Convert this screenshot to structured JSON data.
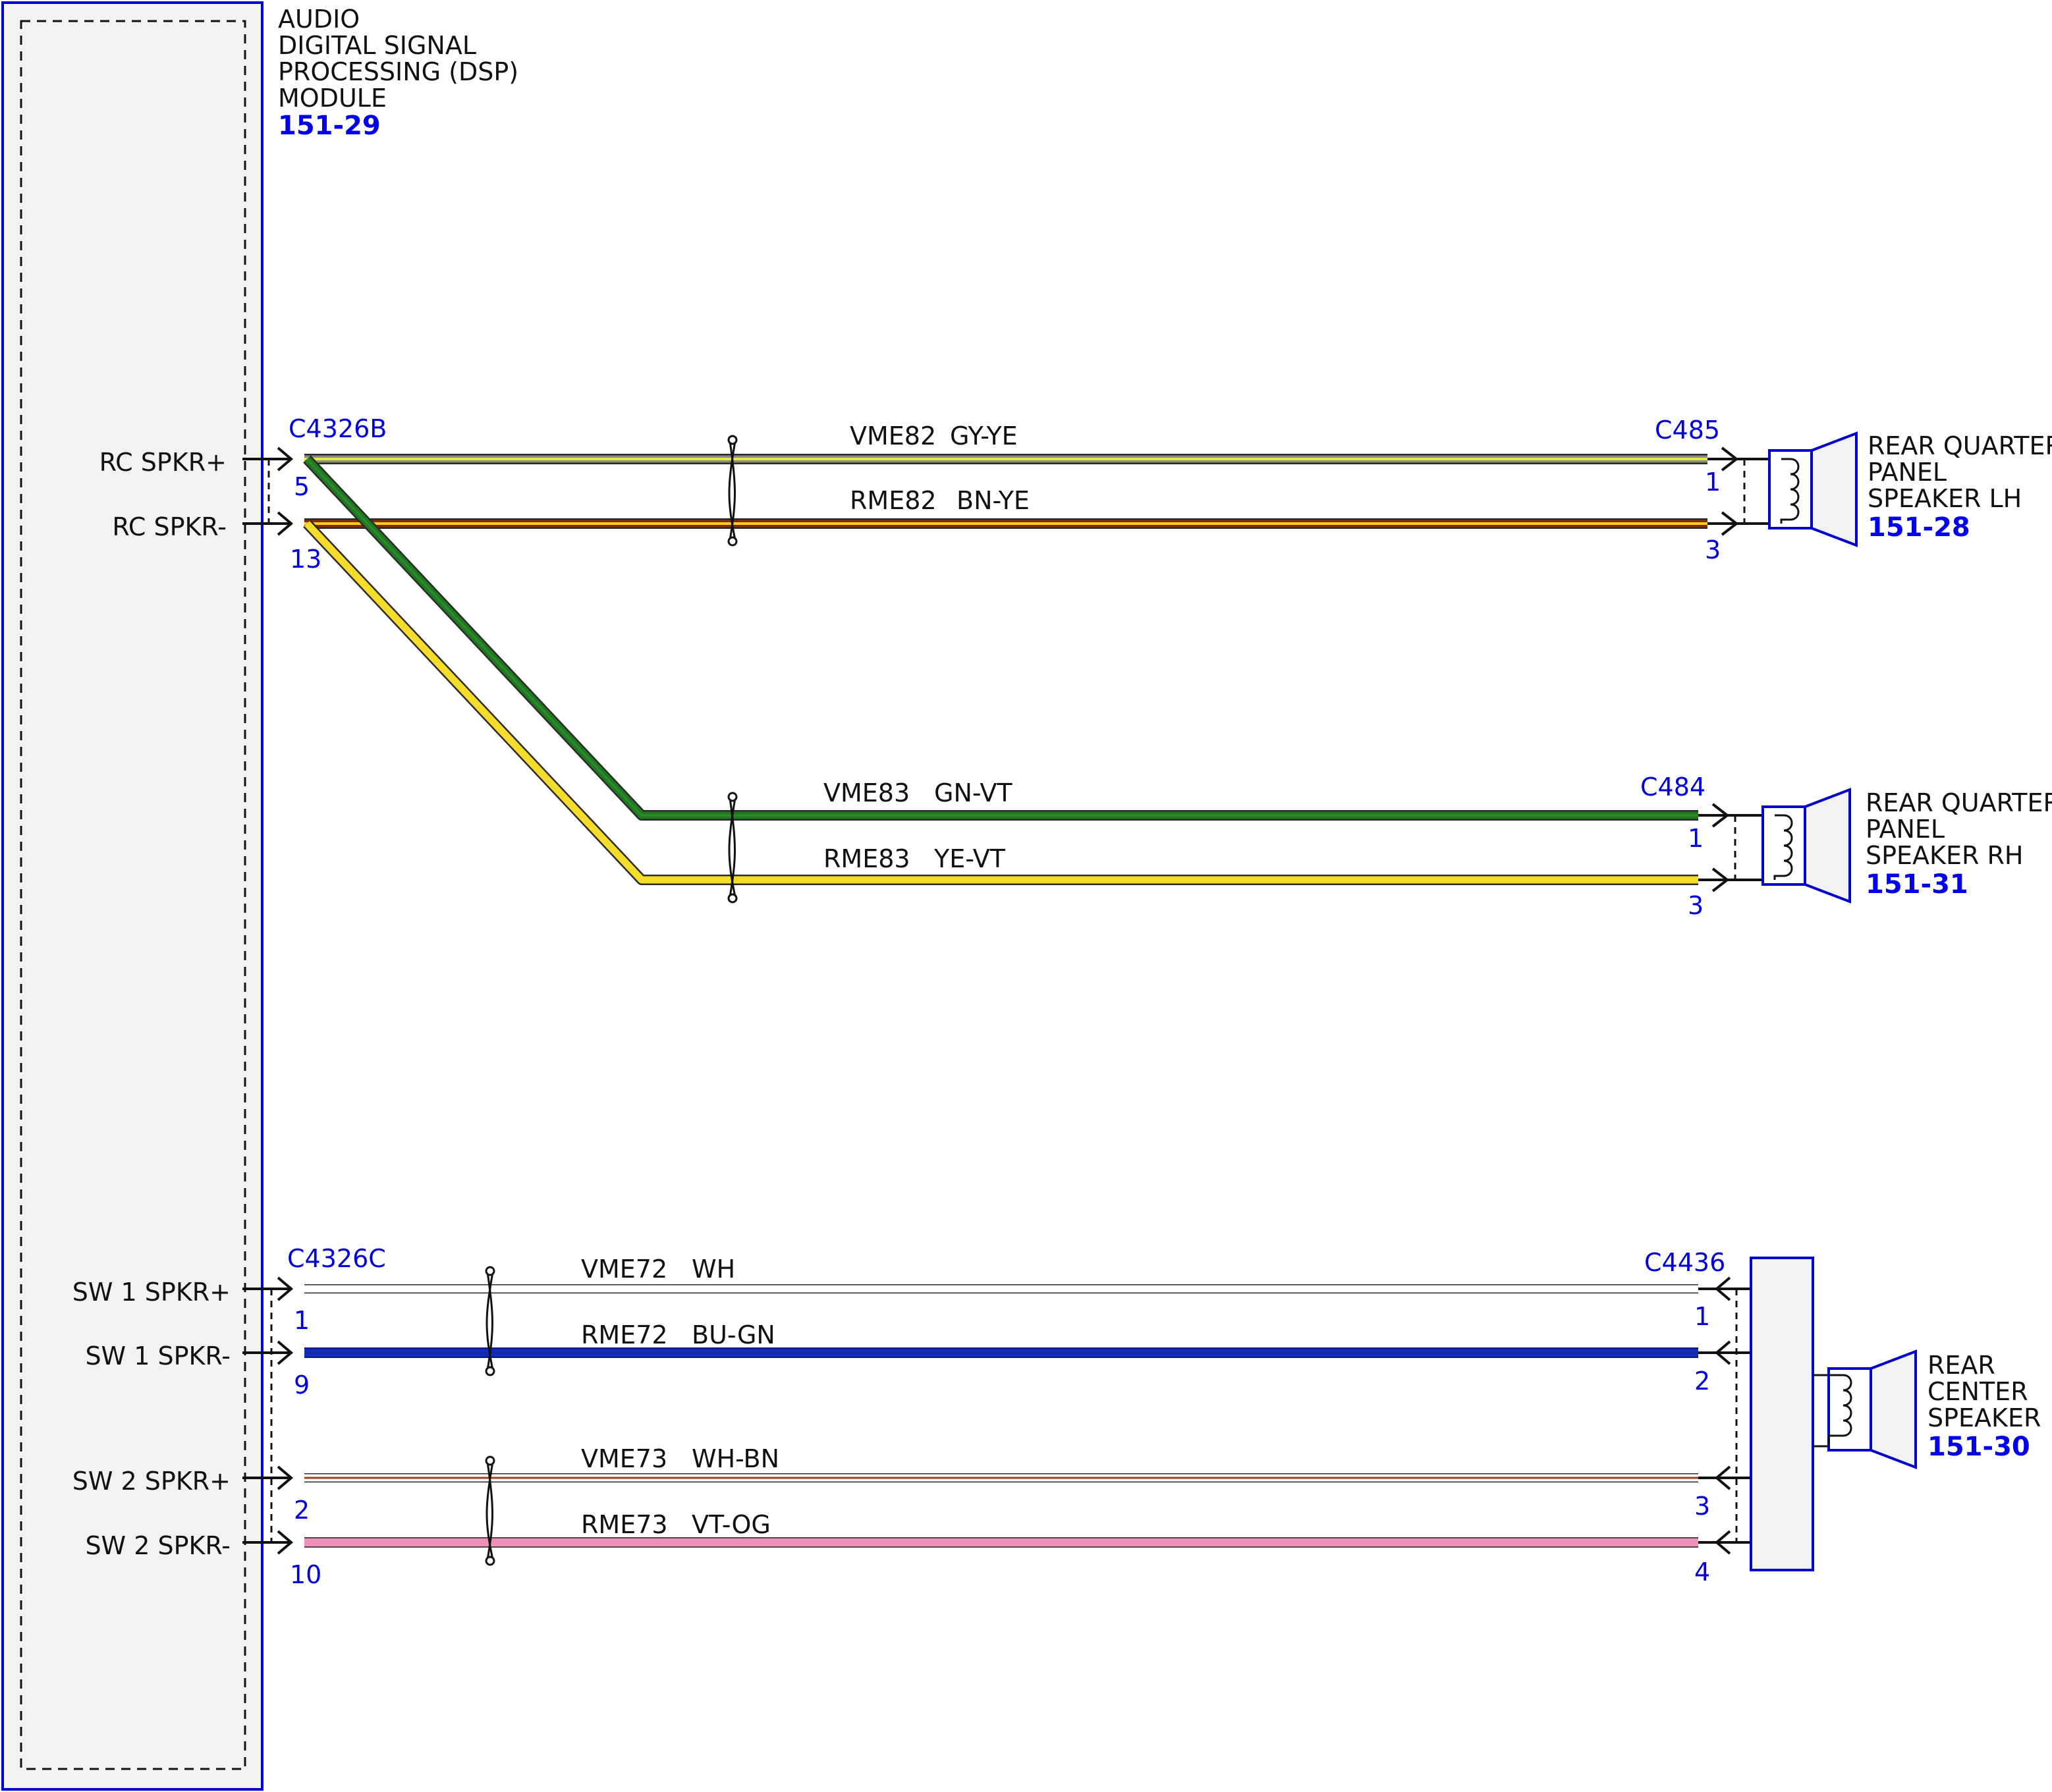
{
  "colors": {
    "component_outline": "#0000cc",
    "module_fill": "#f2f2f2",
    "reference_text": "#0000ee",
    "pin_text": "#0000dd",
    "wire_outline": "#2a2a2a"
  },
  "module": {
    "title_lines": [
      "AUDIO",
      "DIGITAL SIGNAL",
      "PROCESSING (DSP)",
      "MODULE"
    ],
    "ref": "151-29"
  },
  "pins": {
    "rc_spkr_pos": "RC SPKR+",
    "rc_spkr_neg": "RC SPKR-",
    "sw1_spkr_pos": "SW 1 SPKR+",
    "sw1_spkr_neg": "SW 1 SPKR-",
    "sw2_spkr_pos": "SW 2 SPKR+",
    "sw2_spkr_neg": "SW 2 SPKR-"
  },
  "connectors": {
    "c4326b": {
      "name": "C4326B",
      "pins": [
        "5",
        "13"
      ]
    },
    "c4326c": {
      "name": "C4326C",
      "pins": [
        "1",
        "9",
        "2",
        "10"
      ]
    },
    "c485": {
      "name": "C485",
      "pins": [
        "1",
        "3"
      ]
    },
    "c484": {
      "name": "C484",
      "pins": [
        "1",
        "3"
      ]
    },
    "c4436": {
      "name": "C4436",
      "pins": [
        "1",
        "2",
        "3",
        "4"
      ]
    }
  },
  "wires": [
    {
      "circuit": "VME82",
      "color_code": "GY-YE",
      "base": "#8a8a8a",
      "stripe": "#e8e83a"
    },
    {
      "circuit": "RME82",
      "color_code": "BN-YE",
      "base": "#8b2a0a",
      "stripe": "#f0d020"
    },
    {
      "circuit": "VME83",
      "color_code": "GN-VT",
      "base": "#1f7a1f",
      "stripe": "#7a3a9a"
    },
    {
      "circuit": "RME83",
      "color_code": "YE-VT",
      "base": "#f5dc2a",
      "stripe": "#f5dc2a"
    },
    {
      "circuit": "VME72",
      "color_code": "WH",
      "base": "#ffffff",
      "stripe": "#ffffff"
    },
    {
      "circuit": "RME72",
      "color_code": "BU-GN",
      "base": "#1030c0",
      "stripe": "#1a6a1a"
    },
    {
      "circuit": "VME73",
      "color_code": "WH-BN",
      "base": "#ffffff",
      "stripe": "#a04020"
    },
    {
      "circuit": "RME73",
      "color_code": "VT-OG",
      "base": "#f090b8",
      "stripe": "#f090b8"
    }
  ],
  "speakers": {
    "lh": {
      "lines": [
        "REAR QUARTER",
        "PANEL",
        "SPEAKER LH"
      ],
      "ref": "151-28"
    },
    "rh": {
      "lines": [
        "REAR QUARTER",
        "PANEL",
        "SPEAKER RH"
      ],
      "ref": "151-31"
    },
    "center": {
      "lines": [
        "REAR",
        "CENTER",
        "SPEAKER"
      ],
      "ref": "151-30"
    }
  }
}
